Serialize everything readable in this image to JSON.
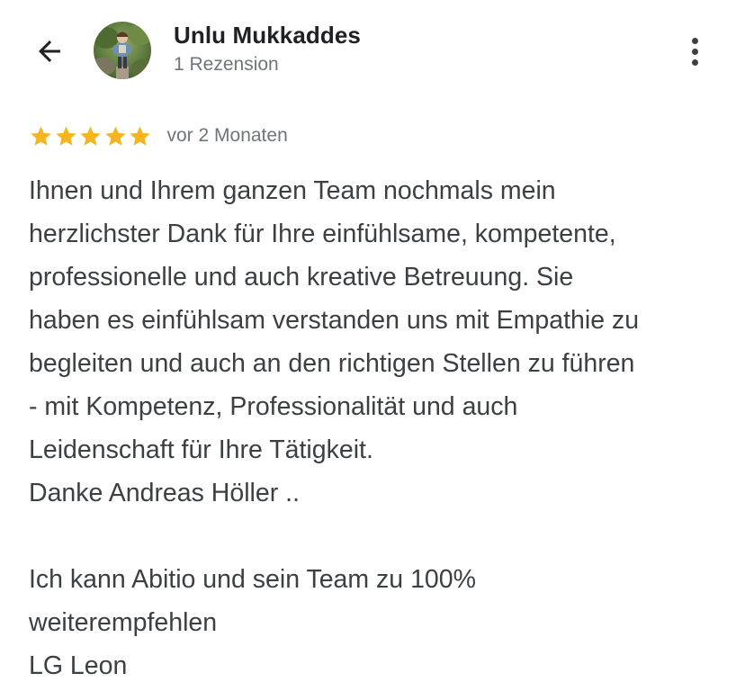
{
  "header": {
    "back_icon": "arrow-left-icon",
    "author_name": "Unlu Mukkaddes",
    "review_count": "1 Rezension",
    "more_icon": "more-vertical-icon"
  },
  "rating": {
    "stars": 5,
    "max_stars": 5,
    "star_color": "#f6b41e",
    "date": "vor 2 Monaten"
  },
  "review": {
    "lines": [
      "Ihnen und Ihrem ganzen Team nochmals mein",
      "herzlichster Dank für Ihre einfühlsame, kompetente,",
      "professionelle und auch kreative Betreuung. Sie",
      "haben es einfühlsam verstanden uns mit Empathie zu",
      "begleiten und auch an den richtigen Stellen zu führen",
      "- mit Kompetenz, Professionalität und auch",
      "Leidenschaft für Ihre Tätigkeit.",
      "Danke Andreas Höller ..",
      "",
      "Ich kann Abitio und sein Team zu 100%",
      "weiterempfehlen",
      "LG Leon"
    ]
  }
}
